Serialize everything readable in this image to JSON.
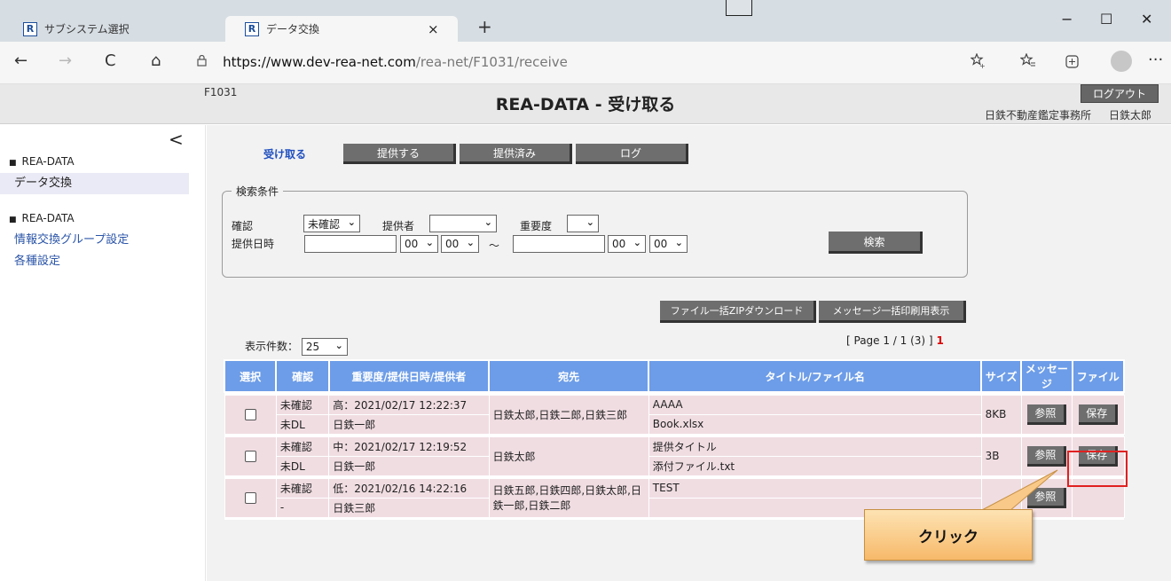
{
  "browser": {
    "tabs": [
      {
        "icon": "R",
        "title": "サブシステム選択",
        "close": "×"
      },
      {
        "icon": "R",
        "title": "データ交換",
        "close": "×"
      }
    ],
    "new_tab": "+",
    "window_controls": {
      "minimize": "−",
      "maximize": "☐",
      "close": "✕"
    },
    "nav": {
      "back": "←",
      "forward": "→",
      "reload": "C",
      "home": "⌂",
      "more": "···"
    },
    "url_host": "https://www.dev-rea-net.com",
    "url_path": "/rea-net/F1031/receive",
    "toolbar_icons": [
      "add-favorite-icon",
      "favorites-icon",
      "collections-icon",
      "profile-icon",
      "more-icon"
    ]
  },
  "header": {
    "screen_id": "F1031",
    "title": "REA-DATA - 受け取る",
    "logout": "ログアウト",
    "office": "日鉄不動産鑑定事務所",
    "user": "日鉄太郎"
  },
  "sidebar": {
    "collapse": "<",
    "sections": [
      {
        "heading": "REA-DATA",
        "items": [
          "データ交換"
        ]
      },
      {
        "heading": "REA-DATA",
        "items": [
          "情報交換グループ設定",
          "各種設定"
        ]
      }
    ]
  },
  "subtabs": {
    "current": "受け取る",
    "provide": "提供する",
    "provided": "提供済み",
    "log": "ログ"
  },
  "search": {
    "legend": "検索条件",
    "confirm_label": "確認",
    "confirm_value": "未確認",
    "provider_label": "提供者",
    "provider_value": "",
    "priority_label": "重要度",
    "priority_value": "",
    "date_label": "提供日時",
    "hour_from": "00",
    "min_from": "00",
    "tilde": "～",
    "hour_to": "00",
    "min_to": "00",
    "search_button": "検索"
  },
  "actions": {
    "zip_download": "ファイル一括ZIPダウンロード",
    "print_messages": "メッセージ一括印刷用表示"
  },
  "list": {
    "count_label": "表示件数：",
    "count_value": "25",
    "pager_prefix": "[ Page 1 / 1 (3) ]",
    "pager_current": "1",
    "columns": [
      "選択",
      "確認",
      "重要度/提供日時/提供者",
      "宛先",
      "タイトル/ファイル名",
      "サイズ",
      "メッセージ",
      "ファイル"
    ],
    "rows": [
      {
        "confirm": "未確認",
        "dl": "未DL",
        "priority_date": "高：2021/02/17 12:22:37",
        "provider": "日鉄一郎",
        "recipients": "日鉄太郎,日鉄二郎,日鉄三郎",
        "title": "AAAA",
        "file": "Book.xlsx",
        "size": "8KB",
        "message_btn": "参照",
        "file_btn": "保存"
      },
      {
        "confirm": "未確認",
        "dl": "未DL",
        "priority_date": "中：2021/02/17 12:19:52",
        "provider": "日鉄一郎",
        "recipients": "日鉄太郎",
        "title": "提供タイトル",
        "file": "添付ファイル.txt",
        "size": "3B",
        "message_btn": "参照",
        "file_btn": "保存"
      },
      {
        "confirm": "未確認",
        "dl": "-",
        "priority_date": "低：2021/02/16 14:22:16",
        "provider": "日鉄三郎",
        "recipients": "日鉄五郎,日鉄四郎,日鉄太郎,日鉄一郎,日鉄二郎",
        "title": "TEST",
        "file": "",
        "size": "",
        "message_btn": "参照",
        "file_btn": ""
      }
    ]
  },
  "annotation": {
    "callout": "クリック",
    "highlight_color": "#e02020"
  },
  "colors": {
    "table_header": "#6d9de8",
    "row_bg": "#f0dde2",
    "button": "#6e6e6e",
    "link": "#2b55a8"
  }
}
